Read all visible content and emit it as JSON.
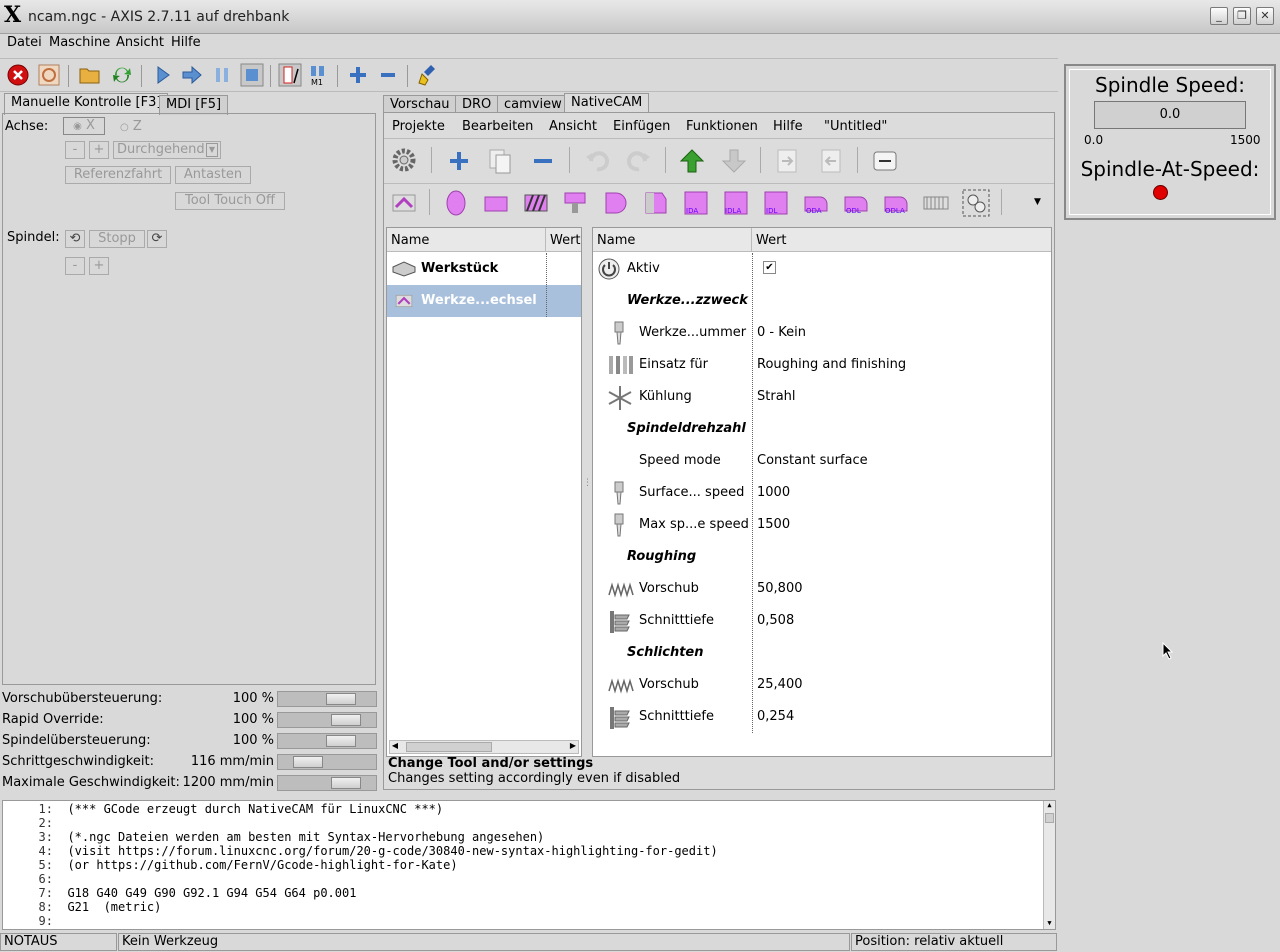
{
  "window": {
    "title": "ncam.ngc - AXIS 2.7.11 auf  drehbank",
    "logo": "X"
  },
  "menubar": [
    "Datei",
    "Maschine",
    "Ansicht",
    "Hilfe"
  ],
  "left_tabs": [
    "Manuelle Kontrolle [F3]",
    "MDI [F5]"
  ],
  "manual": {
    "axis_label": "Achse:",
    "axis_x": "X",
    "axis_z": "Z",
    "minus": "-",
    "plus": "+",
    "jog_mode": "Durchgehend",
    "home_button": "Referenzfahrt",
    "touch_button": "Antasten",
    "tool_touch_button": "Tool Touch Off",
    "spindle_label": "Spindel:",
    "spindle_stop": "Stopp"
  },
  "overrides": [
    {
      "name": "Vorschubübersteuerung:",
      "value": "100 %",
      "level": 0.7
    },
    {
      "name": "Rapid Override:",
      "value": "100 %",
      "level": 0.78
    },
    {
      "name": "Spindelübersteuerung:",
      "value": "100 %",
      "level": 0.7
    },
    {
      "name": "Schrittgeschwindigkeit:",
      "value": "116 mm/min",
      "level": 0.22
    },
    {
      "name": "Maximale Geschwindigkeit:",
      "value": "1200 mm/min",
      "level": 0.78
    }
  ],
  "right_tabs": [
    "Vorschau",
    "DRO",
    "camview",
    "NativeCAM"
  ],
  "ncam_menu": [
    "Projekte",
    "Bearbeiten",
    "Ansicht",
    "Einfügen",
    "Funktionen",
    "Hilfe",
    "\"Untitled\""
  ],
  "tree": {
    "headers": [
      "Name",
      "Wert"
    ],
    "items": [
      {
        "label": "Werkstück",
        "selected": false
      },
      {
        "label": "Werkze...echsel",
        "selected": true
      }
    ]
  },
  "props": {
    "headers": [
      "Name",
      "Wert"
    ],
    "rows": [
      {
        "name": "Aktiv",
        "value": "",
        "icon": "power-icon",
        "check": true,
        "section": false
      },
      {
        "name": "Werkze...zzweck",
        "value": "",
        "icon": "",
        "section": true
      },
      {
        "name": "Werkze...ummer",
        "value": "0 - Kein",
        "icon": "tool-icon",
        "section": false
      },
      {
        "name": "Einsatz für",
        "value": "Roughing and finishing",
        "icon": "tools-icon",
        "section": false
      },
      {
        "name": "Kühlung",
        "value": "Strahl",
        "icon": "snowflake-icon",
        "section": false
      },
      {
        "name": "Spindeldrehzahl",
        "value": "",
        "icon": "",
        "section": true
      },
      {
        "name": "Speed mode",
        "value": "Constant surface",
        "icon": "",
        "section": false
      },
      {
        "name": "Surface... speed",
        "value": "1000",
        "icon": "tool-icon",
        "section": false
      },
      {
        "name": "Max sp...e speed",
        "value": "1500",
        "icon": "tool-icon",
        "section": false
      },
      {
        "name": "Roughing",
        "value": "",
        "icon": "",
        "section": true
      },
      {
        "name": "Vorschub",
        "value": "50,800",
        "icon": "feed-icon",
        "section": false
      },
      {
        "name": "Schnitttiefe",
        "value": "0,508",
        "icon": "depth-icon",
        "section": false
      },
      {
        "name": "Schlichten",
        "value": "",
        "icon": "",
        "section": true
      },
      {
        "name": "Vorschub",
        "value": "25,400",
        "icon": "feed-icon",
        "section": false
      },
      {
        "name": "Schnitttiefe",
        "value": "0,254",
        "icon": "depth-icon",
        "section": false
      }
    ]
  },
  "help": {
    "title": "Change Tool and/or settings",
    "text": "Changes setting accordingly even if disabled"
  },
  "spindle": {
    "speed_title": "Spindle Speed:",
    "speed_value": "0.0",
    "scale_min": "0.0",
    "scale_max": "1500",
    "at_speed_title": "Spindle-At-Speed:",
    "led_color": "#e00000"
  },
  "gcode": [
    {
      "n": "1:",
      "t": "(*** GCode erzeugt durch NativeCAM für LinuxCNC ***)"
    },
    {
      "n": "2:",
      "t": ""
    },
    {
      "n": "3:",
      "t": "(*.ngc Dateien werden am besten mit Syntax-Hervorhebung angesehen)"
    },
    {
      "n": "4:",
      "t": "(visit https://forum.linuxcnc.org/forum/20-g-code/30840-new-syntax-highlighting-for-gedit)"
    },
    {
      "n": "5:",
      "t": "(or https://github.com/FernV/Gcode-highlight-for-Kate)"
    },
    {
      "n": "6:",
      "t": ""
    },
    {
      "n": "7:",
      "t": "G18 G40 G49 G90 G92.1 G94 G54 G64 p0.001"
    },
    {
      "n": "8:",
      "t": "G21  (metric)"
    },
    {
      "n": "9:",
      "t": ""
    }
  ],
  "status": {
    "estop": "NOTAUS",
    "tool": "Kein Werkzeug",
    "position": "Position: relativ aktuell"
  }
}
